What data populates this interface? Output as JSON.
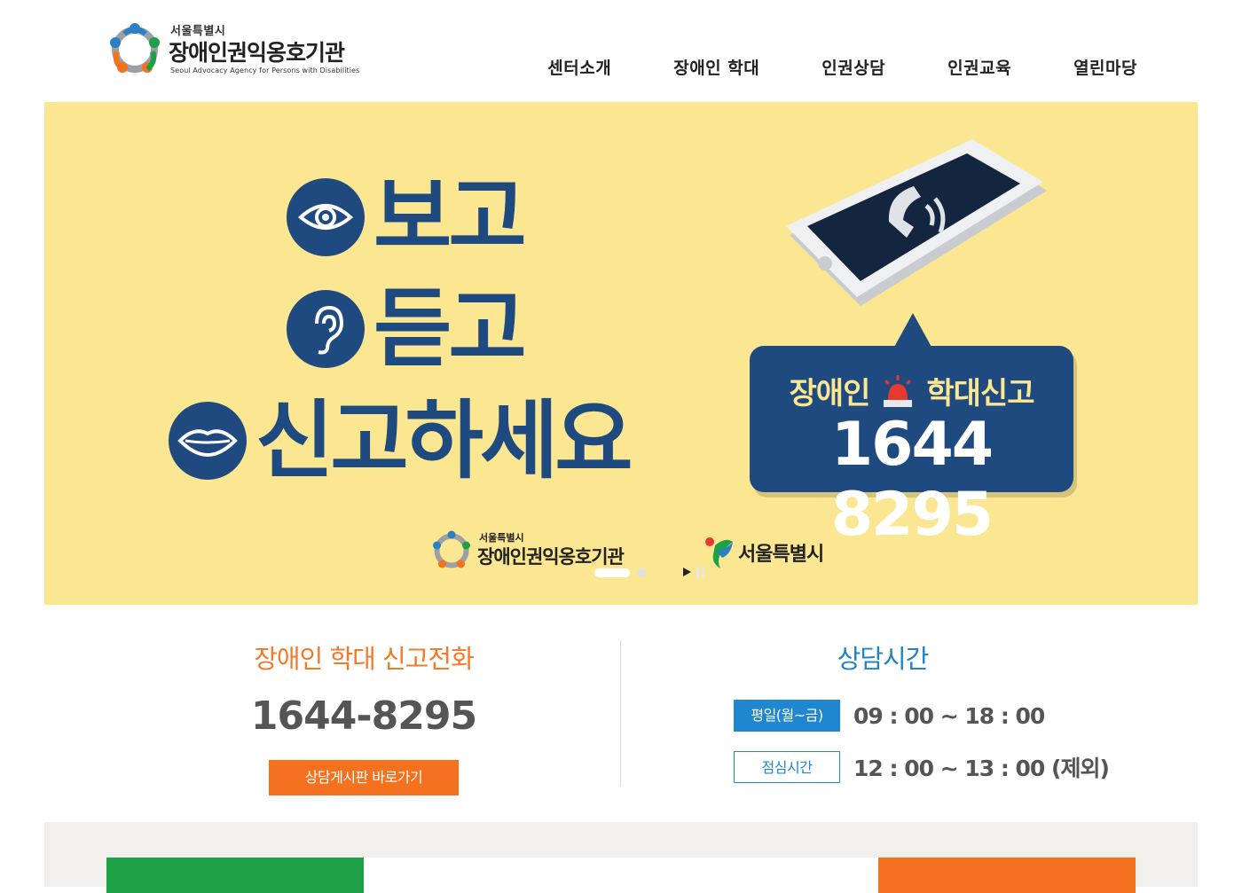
{
  "header": {
    "logo_small": "서울특별시",
    "logo_main": "장애인권익옹호기관",
    "logo_en": "Seoul Advocacy Agency for Persons with Disabilities",
    "nav": [
      "센터소개",
      "장애인 학대",
      "인권상담",
      "인권교육",
      "열린마당"
    ]
  },
  "banner": {
    "slogan_see": "보고",
    "slogan_hear": "듣고",
    "slogan_report": "신고하세요",
    "report_left": "장애인",
    "report_right": "학대신고",
    "report_number": "1644 8295",
    "footer_logo_small": "서울특별시",
    "footer_logo_main": "장애인권익옹호기관",
    "seoul_logo": "서울특별시",
    "colors": {
      "background": "#fbe691",
      "navy": "#1f4a80"
    }
  },
  "info": {
    "hotline_title": "장애인 학대 신고전화",
    "hotline_number": "1644-8295",
    "board_button": "상담게시판 바로가기",
    "hours_title": "상담시간",
    "weekday_label": "평일(월~금)",
    "weekday_hours": "09 : 00 ~ 18 : 00",
    "lunch_label": "점심시간",
    "lunch_hours": "12 : 00 ~ 13 : 00 (제외)",
    "colors": {
      "orange": "#f4721f",
      "blue": "#1f87d0"
    }
  }
}
